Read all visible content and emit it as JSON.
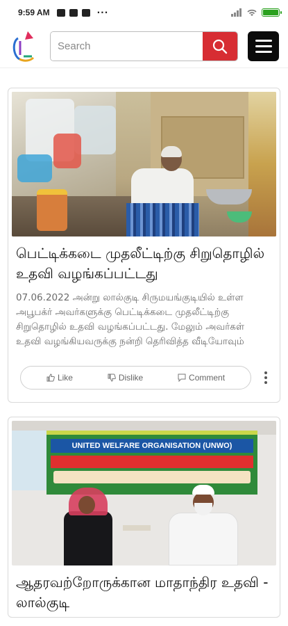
{
  "status_bar": {
    "time": "9:59 AM",
    "more": "···"
  },
  "header": {
    "search_placeholder": "Search"
  },
  "posts": [
    {
      "title": "பெட்டிக்கடை முதலீட்டிற்கு சிறுதொழில் உதவி வழங்கப்பட்டது",
      "description": "07.06.2022 அன்று லால்குடி சிருமயங்குடியில் உள்ள அபூபக்ர் அவர்களுக்கு பெட்டிக்கடை முதலீட்டிற்கு சிறுதொழில் உதவி வழங்கப்பட்டது. மேலும் அவர்கள் உதவி வழங்கியவருக்கு நன்றி தெரிவித்த வீடியோவும்",
      "actions": {
        "like": "Like",
        "dislike": "Dislike",
        "comment": "Comment"
      }
    },
    {
      "title": "ஆதரவற்றோருக்கான மாதாந்திர உதவி - லால்குடி",
      "banner_text": "UNITED WELFARE ORGANISATION (UNWO)"
    }
  ],
  "colors": {
    "accent_red": "#d72d33",
    "menu_black": "#0b0b0b",
    "battery_green": "#2aa11e"
  },
  "icons": {
    "search": "magnifier-icon",
    "menu": "hamburger-icon",
    "like": "thumbs-up-icon",
    "dislike": "thumbs-down-icon",
    "comment": "comment-icon",
    "more": "vertical-dots-icon"
  }
}
